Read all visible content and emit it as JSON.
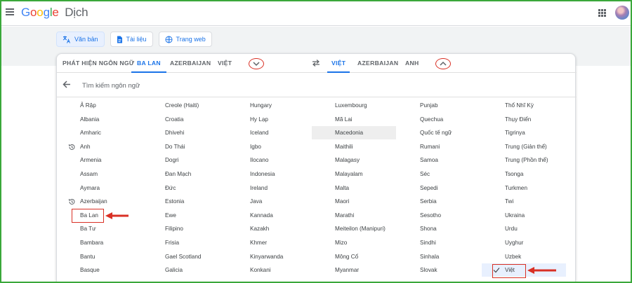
{
  "app": {
    "logo_letters": [
      "G",
      "o",
      "o",
      "g",
      "l",
      "e"
    ],
    "product": "Dịch"
  },
  "modes": [
    {
      "label": "Văn bản",
      "icon": "translate-icon",
      "active": true
    },
    {
      "label": "Tài liệu",
      "icon": "document-icon",
      "active": false
    },
    {
      "label": "Trang web",
      "icon": "globe-icon",
      "active": false
    }
  ],
  "source_tabs": [
    "PHÁT HIỆN NGÔN NGỮ",
    "BA LAN",
    "AZERBAIJAN",
    "VIỆT"
  ],
  "target_tabs": [
    "VIỆT",
    "AZERBAIJAN",
    "ANH"
  ],
  "selected_source": "BA LAN",
  "selected_target": "VIỆT",
  "search": {
    "placeholder": "Tìm kiếm ngôn ngữ"
  },
  "language_columns": [
    [
      "Ả Rập",
      "Albania",
      "Amharic",
      "Anh",
      "Armenia",
      "Assam",
      "Aymara",
      "Azerbaijan",
      "Ba Lan",
      "Ba Tư",
      "Bambara",
      "Bantu",
      "Basque"
    ],
    [
      "Creole (Haiti)",
      "Croatia",
      "Dhivehi",
      "Do Thái",
      "Dogri",
      "Đan Mạch",
      "Đức",
      "Estonia",
      "Ewe",
      "Filipino",
      "Frisia",
      "Gael Scotland",
      "Galicia"
    ],
    [
      "Hungary",
      "Hy Lạp",
      "Iceland",
      "Igbo",
      "Ilocano",
      "Indonesia",
      "Ireland",
      "Java",
      "Kannada",
      "Kazakh",
      "Khmer",
      "Kinyarwanda",
      "Konkani"
    ],
    [
      "Luxembourg",
      "Mã Lai",
      "Macedonia",
      "Maithili",
      "Malagasy",
      "Malayalam",
      "Malta",
      "Maori",
      "Marathi",
      "Meiteilon (Manipuri)",
      "Mizo",
      "Mông Cổ",
      "Myanmar"
    ],
    [
      "Punjab",
      "Quechua",
      "Quốc tế ngữ",
      "Rumani",
      "Samoa",
      "Séc",
      "Sepedi",
      "Serbia",
      "Sesotho",
      "Shona",
      "Sindhi",
      "Sinhala",
      "Slovak"
    ],
    [
      "Thổ Nhĩ Kỳ",
      "Thụy Điển",
      "Tigrinya",
      "Trung (Giản thể)",
      "Trung (Phồn thể)",
      "Tsonga",
      "Turkmen",
      "Twi",
      "Ukraina",
      "Urdu",
      "Uyghur",
      "Uzbek",
      "Việt"
    ]
  ],
  "recent_languages": [
    "Anh",
    "Azerbaijan"
  ],
  "hovered_language": "Macedonia",
  "checked_language": "Việt",
  "annotation_color": "#d93025",
  "accent_color": "#1a73e8"
}
